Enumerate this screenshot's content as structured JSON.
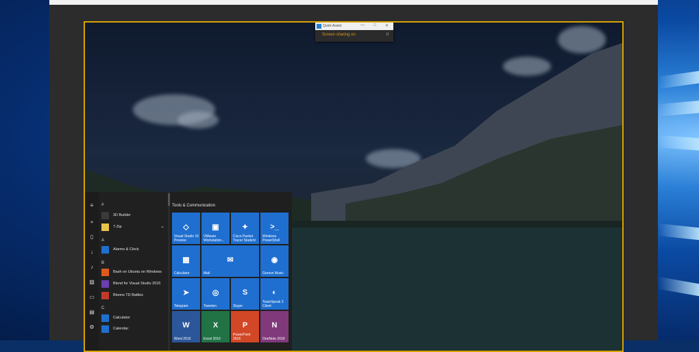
{
  "quick_assist": {
    "title": "Quick Assist",
    "status": "Screen sharing on",
    "pause_label": "II",
    "minimize_label": "—",
    "maximize_label": "□",
    "close_label": "✕"
  },
  "start_menu": {
    "rail_icons": [
      "hamburger-icon",
      "user-avatar-icon",
      "documents-icon",
      "downloads-icon",
      "music-icon",
      "pictures-icon",
      "videos-icon",
      "network-icon",
      "settings-icon"
    ],
    "app_list": {
      "groups": [
        {
          "letter": "#",
          "items": [
            {
              "label": "3D Builder",
              "icon_color": "#3a3a3a"
            },
            {
              "label": "7-Zip",
              "icon_color": "#e8c44a",
              "has_expand": true
            }
          ]
        },
        {
          "letter": "A",
          "items": [
            {
              "label": "Alarms & Clock",
              "icon_color": "#1f6fd0"
            }
          ]
        },
        {
          "letter": "B",
          "items": [
            {
              "label": "Bash on Ubuntu on Windows",
              "icon_color": "#e05a1c"
            },
            {
              "label": "Blend for Visual Studio 2015",
              "icon_color": "#6a3fb0"
            },
            {
              "label": "Bloons TD Battles",
              "icon_color": "#c0392b"
            }
          ]
        },
        {
          "letter": "C",
          "items": [
            {
              "label": "Calculator",
              "icon_color": "#1f6fd0"
            },
            {
              "label": "Calendar",
              "icon_color": "#1f6fd0"
            }
          ]
        }
      ],
      "expand_glyph": "⌄"
    },
    "tiles": {
      "group_title": "Tools & Communication",
      "items": [
        {
          "label": "Visual Studio 15 Preview",
          "color": "#1f6fd0",
          "glyph": "◇"
        },
        {
          "label": "VMware Workstation...",
          "color": "#1f6fd0",
          "glyph": "▣"
        },
        {
          "label": "Cisco Packet Tracer Student",
          "color": "#1f6fd0",
          "glyph": "✦"
        },
        {
          "label": "Windows PowerShell",
          "color": "#1f6fd0",
          "glyph": ">_"
        },
        {
          "label": "Calculator",
          "color": "#1f6fd0",
          "glyph": "▦"
        },
        {
          "label": "Mail",
          "color": "#1f6fd0",
          "glyph": "✉"
        },
        {
          "label": "Groove Music",
          "color": "#1f6fd0",
          "glyph": "◉"
        },
        {
          "label": "Telegram",
          "color": "#1f6fd0",
          "glyph": "➤"
        },
        {
          "label": "Tweeten",
          "color": "#1f6fd0",
          "glyph": "◎"
        },
        {
          "label": "Skype",
          "color": "#1f6fd0",
          "glyph": "S"
        },
        {
          "label": "TeamSpeak 3 Client",
          "color": "#1f6fd0",
          "glyph": "◐"
        },
        {
          "label": "Word 2016",
          "color": "#2b579a",
          "glyph": "W"
        },
        {
          "label": "Excel 2016",
          "color": "#217346",
          "glyph": "X"
        },
        {
          "label": "PowerPoint 2016",
          "color": "#d24726",
          "glyph": "P"
        },
        {
          "label": "OneNote 2016",
          "color": "#80397b",
          "glyph": "N"
        }
      ]
    }
  }
}
